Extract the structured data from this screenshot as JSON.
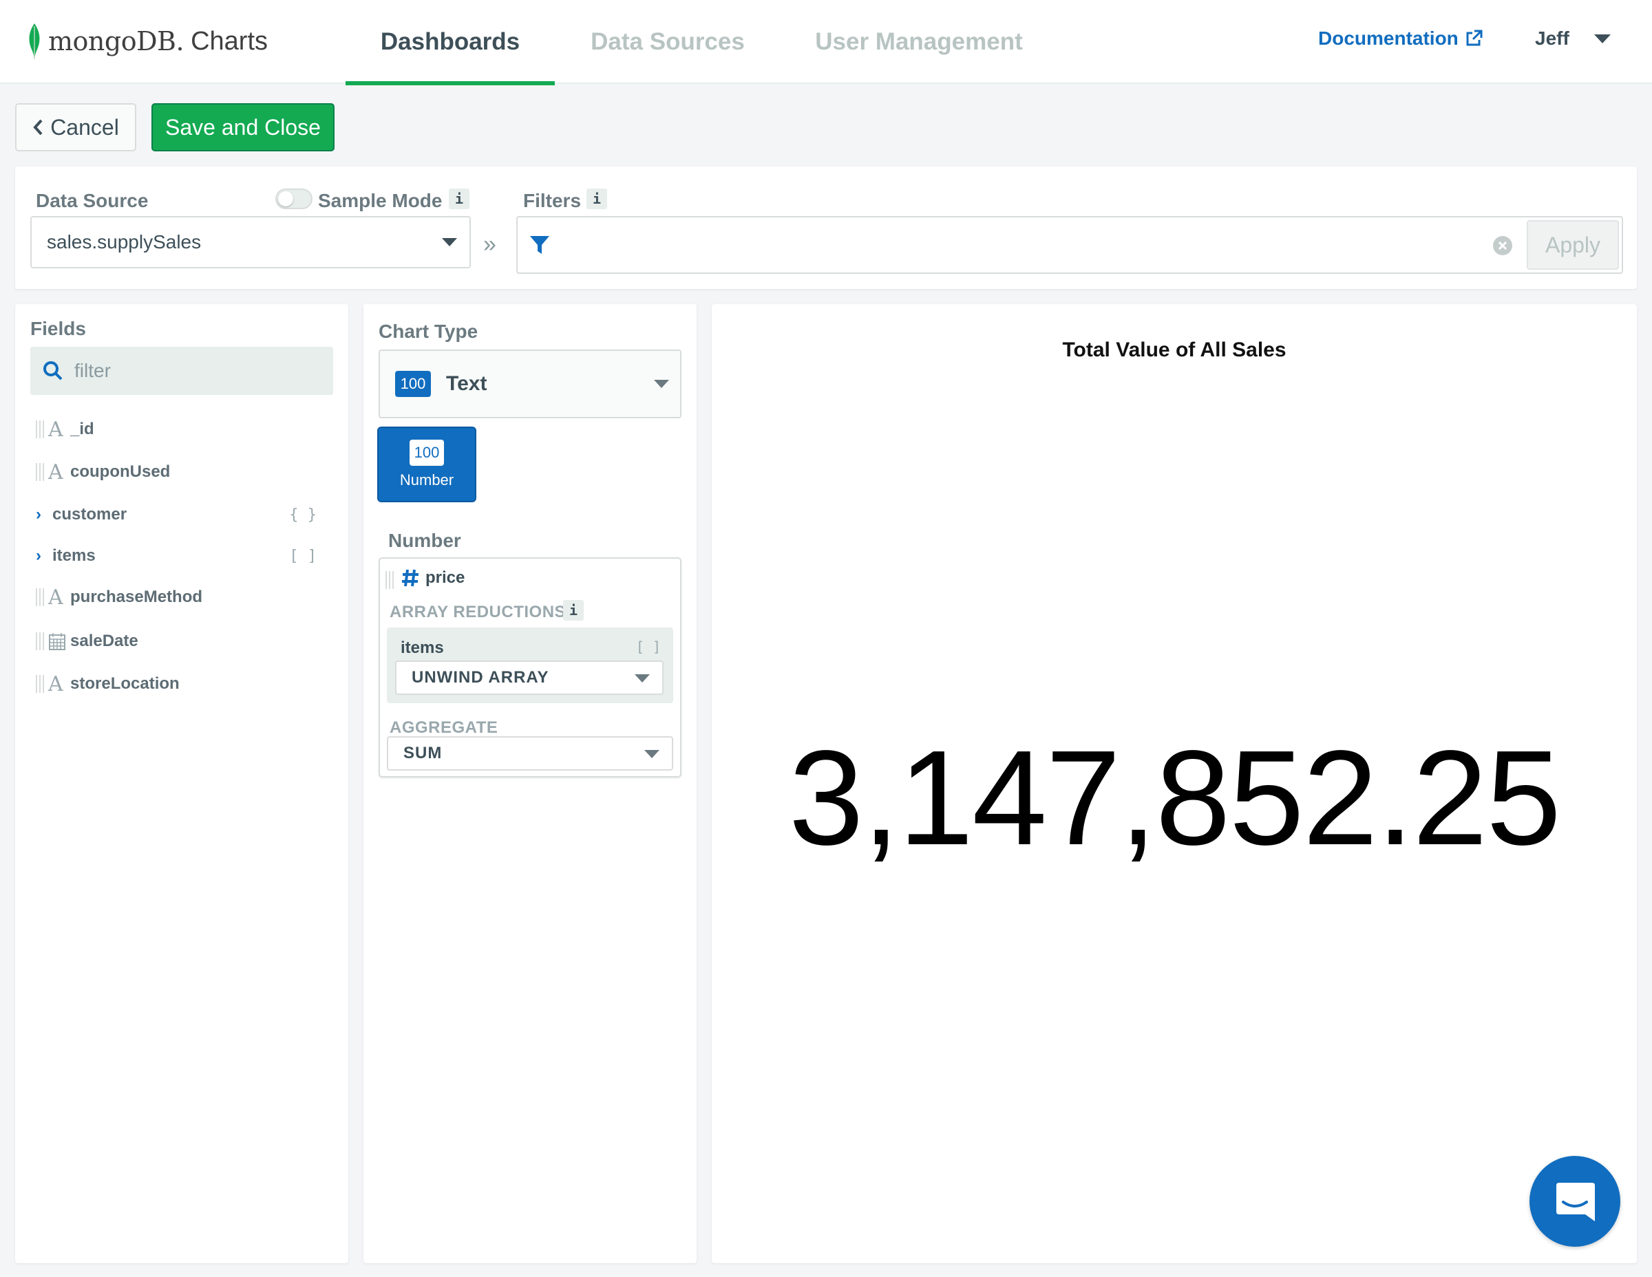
{
  "app": {
    "logo_mongo": "mongoDB",
    "logo_suffix": ".",
    "logo_product": "Charts"
  },
  "nav": {
    "tabs": [
      {
        "label": "Dashboards",
        "active": true
      },
      {
        "label": "Data Sources",
        "active": false
      },
      {
        "label": "User Management",
        "active": false
      }
    ],
    "documentation": "Documentation",
    "user": "Jeff"
  },
  "actions": {
    "cancel": "Cancel",
    "save": "Save and Close"
  },
  "datasource": {
    "label": "Data Source",
    "sample_mode_label": "Sample Mode",
    "sample_mode_on": false,
    "selected": "sales.supplySales",
    "filters_label": "Filters",
    "filter_value": "",
    "apply": "Apply"
  },
  "fields": {
    "title": "Fields",
    "search_placeholder": "filter",
    "items": [
      {
        "name": "_id",
        "type": "string-icon"
      },
      {
        "name": "couponUsed",
        "type": "string-icon"
      },
      {
        "name": "customer",
        "type": "object",
        "marker": "{ }"
      },
      {
        "name": "items",
        "type": "array",
        "marker": "[ ]"
      },
      {
        "name": "purchaseMethod",
        "type": "string-icon"
      },
      {
        "name": "saleDate",
        "type": "calendar-icon"
      },
      {
        "name": "storeLocation",
        "type": "string-icon"
      }
    ]
  },
  "chart_type": {
    "title": "Chart Type",
    "selected_badge": "100",
    "selected": "Text",
    "tile_badge": "100",
    "tile_label": "Number"
  },
  "encoding": {
    "channel_title": "Number",
    "field": "price",
    "array_reductions_label": "ARRAY REDUCTIONS",
    "array_field": "items",
    "array_marker": "[ ]",
    "array_reduction": "UNWIND ARRAY",
    "aggregate_label": "AGGREGATE",
    "aggregate": "SUM"
  },
  "visualization": {
    "title": "Total Value of All Sales",
    "value": "3,147,852.25"
  },
  "colors": {
    "brand_green": "#13aa52",
    "link_blue": "#116dbf",
    "text": "#3d4f58"
  }
}
